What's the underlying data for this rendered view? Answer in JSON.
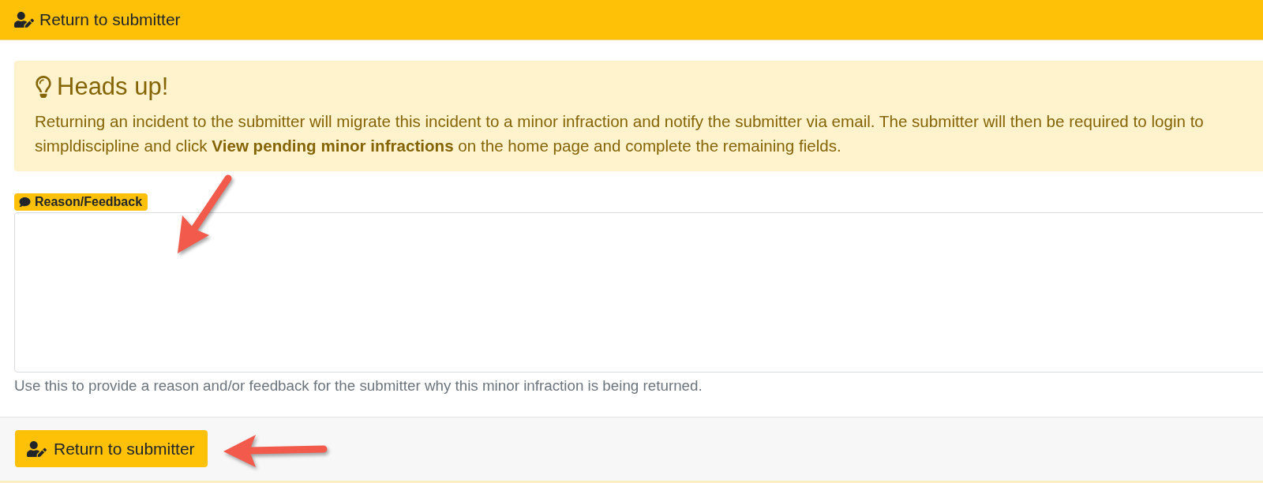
{
  "header": {
    "title": "Return to submitter"
  },
  "alert": {
    "heading": "Heads up!",
    "message": "Returning an incident to the submitter will migrate this incident to a minor infraction and notify the submitter via email. The submitter will then be required to login to simpldiscipline and click **View pending minor infractions** on the home page and complete the remaining fields."
  },
  "reason_field": {
    "label": "Reason/Feedback",
    "help_text": "Use this to provide a reason and/or feedback for the submitter why this minor infraction is being returned."
  },
  "footer": {
    "buttons": [
      {
        "label": "Return to submitter",
        "kind": "primary"
      }
    ]
  }
}
